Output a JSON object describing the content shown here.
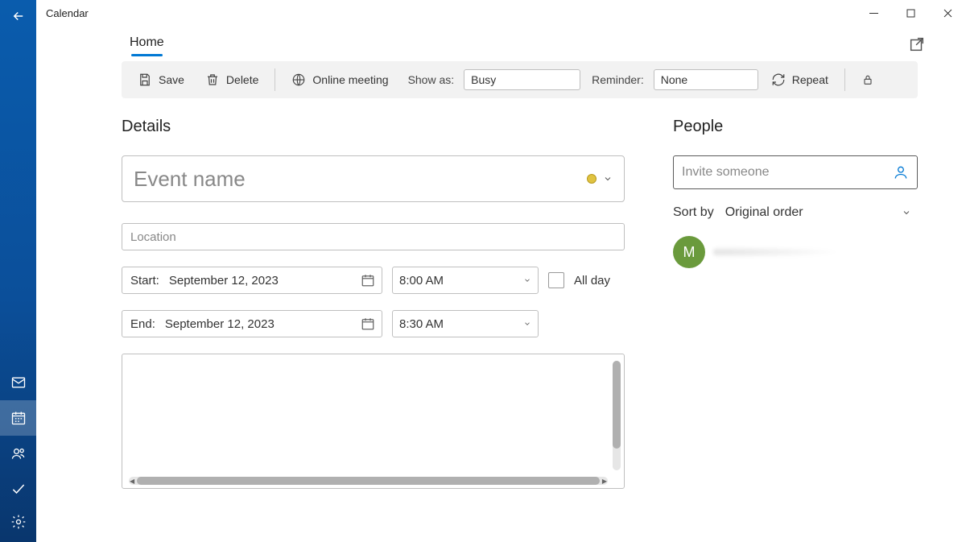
{
  "window": {
    "title": "Calendar"
  },
  "tabs": {
    "home": "Home"
  },
  "toolbar": {
    "save_label": "Save",
    "delete_label": "Delete",
    "online_meeting_label": "Online meeting",
    "show_as_label": "Show as:",
    "show_as_value": "Busy",
    "reminder_label": "Reminder:",
    "reminder_value": "None",
    "repeat_label": "Repeat"
  },
  "details": {
    "section_title": "Details",
    "event_name_placeholder": "Event name",
    "event_name_value": "",
    "location_placeholder": "Location",
    "location_value": "",
    "start_label": "Start:",
    "start_date": "September 12, 2023",
    "start_time": "8:00 AM",
    "end_label": "End:",
    "end_date": "September 12, 2023",
    "end_time": "8:30 AM",
    "allday_label": "All day",
    "allday_checked": false,
    "description_value": ""
  },
  "people": {
    "section_title": "People",
    "invite_placeholder": "Invite someone",
    "sort_label": "Sort by",
    "sort_value": "Original order",
    "attendees": [
      {
        "initial": "M"
      }
    ]
  },
  "colors": {
    "accent": "#0078d4",
    "category_dot": "#e0c341",
    "avatar_bg": "#6a9a3c"
  }
}
